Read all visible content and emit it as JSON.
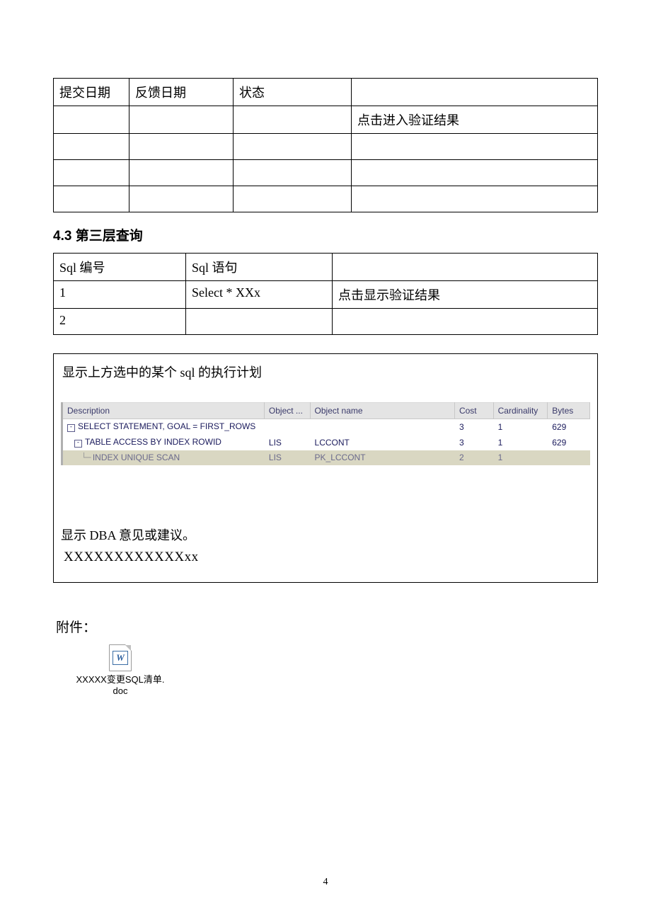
{
  "table1": {
    "headers": [
      "提交日期",
      "反馈日期",
      "状态",
      ""
    ],
    "rows": [
      [
        "",
        "",
        "",
        "点击进入验证结果"
      ],
      [
        "",
        "",
        "",
        ""
      ],
      [
        "",
        "",
        "",
        ""
      ],
      [
        "",
        "",
        "",
        ""
      ]
    ]
  },
  "section_title": "4.3 第三层查询",
  "table2": {
    "headers": [
      "Sql 编号",
      "Sql 语句",
      ""
    ],
    "rows": [
      [
        "1",
        "Select * XXx",
        "点击显示验证结果"
      ],
      [
        "2",
        "",
        ""
      ]
    ]
  },
  "plan": {
    "title": "显示上方选中的某个 sql 的执行计划",
    "columns": [
      "Description",
      "Object ...",
      "Object name",
      "Cost",
      "Cardinality",
      "Bytes"
    ],
    "rows": [
      {
        "indent": 0,
        "toggle": true,
        "desc": "SELECT STATEMENT, GOAL = FIRST_ROWS",
        "obj": "",
        "name": "",
        "cost": "3",
        "card": "1",
        "bytes": "629",
        "hl": false
      },
      {
        "indent": 1,
        "toggle": true,
        "desc": "TABLE ACCESS BY INDEX ROWID",
        "obj": "LIS",
        "name": "LCCONT",
        "cost": "3",
        "card": "1",
        "bytes": "629",
        "hl": false
      },
      {
        "indent": 2,
        "toggle": false,
        "desc": "INDEX UNIQUE SCAN",
        "obj": "LIS",
        "name": "PK_LCCONT",
        "cost": "2",
        "card": "1",
        "bytes": "",
        "hl": true
      }
    ]
  },
  "dba": {
    "line1": "显示 DBA 意见或建议。",
    "line2": "XXXXXXXXXXXXxx"
  },
  "attachment": {
    "label": "附件：",
    "file_line1": "XXXXX变更SQL清单.",
    "file_line2": "doc",
    "icon_letter": "W"
  },
  "page_number": "4"
}
